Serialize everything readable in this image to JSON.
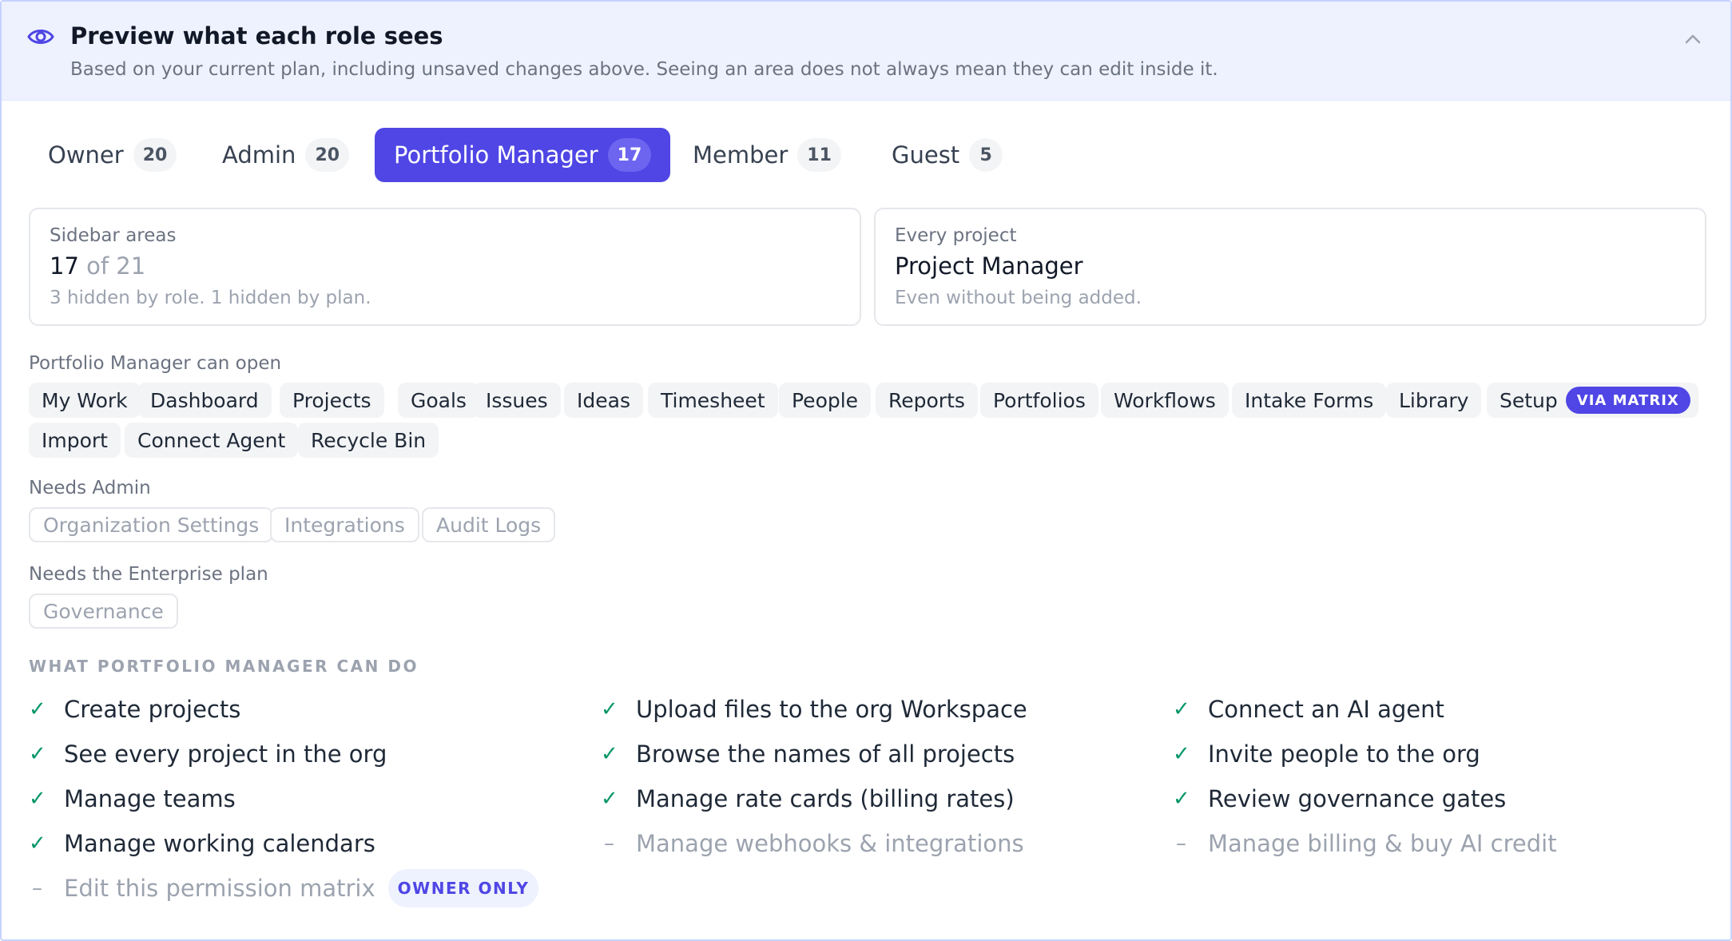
{
  "header": {
    "title": "Preview what each role sees",
    "subtitle": "Based on your current plan, including unsaved changes above. Seeing an area does not always mean they can edit inside it."
  },
  "tabs": [
    {
      "label": "Owner",
      "count": "20",
      "active": false
    },
    {
      "label": "Admin",
      "count": "20",
      "active": false
    },
    {
      "label": "Portfolio Manager",
      "count": "17",
      "active": true
    },
    {
      "label": "Member",
      "count": "11",
      "active": false
    },
    {
      "label": "Guest",
      "count": "5",
      "active": false
    }
  ],
  "sidebar_card": {
    "label": "Sidebar areas",
    "value": "17",
    "value_suffix": "of 21",
    "note": "3 hidden by role. 1 hidden by plan."
  },
  "project_card": {
    "label": "Every project",
    "value": "Project Manager",
    "note": "Even without being added."
  },
  "can_open": {
    "label": "Portfolio Manager can open",
    "items": [
      "My Work",
      "Dashboard",
      "Projects",
      "Goals",
      "Issues",
      "Ideas",
      "Timesheet",
      "People",
      "Reports",
      "Portfolios",
      "Workflows",
      "Intake Forms",
      "Library",
      "Setup",
      "Import",
      "Connect Agent",
      "Recycle Bin"
    ],
    "setup_badge": "VIA MATRIX"
  },
  "needs_admin": {
    "label": "Needs Admin",
    "items": [
      "Organization Settings",
      "Integrations",
      "Audit Logs"
    ]
  },
  "needs_enterprise": {
    "label": "Needs the Enterprise plan",
    "items": [
      "Governance"
    ]
  },
  "can_do": {
    "title": "WHAT PORTFOLIO MANAGER CAN DO",
    "check_mark": "✓",
    "dash_mark": "–",
    "owner_badge": "OWNER ONLY",
    "columns": [
      [
        {
          "text": "Create projects",
          "allowed": true
        },
        {
          "text": "See every project in the org",
          "allowed": true
        },
        {
          "text": "Manage teams",
          "allowed": true
        },
        {
          "text": "Manage working calendars",
          "allowed": true
        },
        {
          "text": "Edit this permission matrix",
          "allowed": false
        }
      ],
      [
        {
          "text": "Upload files to the org Workspace",
          "allowed": true
        },
        {
          "text": "Browse the names of all projects",
          "allowed": true
        },
        {
          "text": "Manage rate cards (billing rates)",
          "allowed": true
        },
        {
          "text": "Manage webhooks & integrations",
          "allowed": false
        }
      ],
      [
        {
          "text": "Connect an AI agent",
          "allowed": true
        },
        {
          "text": "Invite people to the org",
          "allowed": true
        },
        {
          "text": "Review governance gates",
          "allowed": true
        },
        {
          "text": "Manage billing & buy AI credit",
          "allowed": false
        }
      ]
    ]
  },
  "colors": {
    "accent": "#4f46e5",
    "header_bg": "#eef2ff",
    "check": "#059669",
    "muted": "#9ca3af"
  }
}
